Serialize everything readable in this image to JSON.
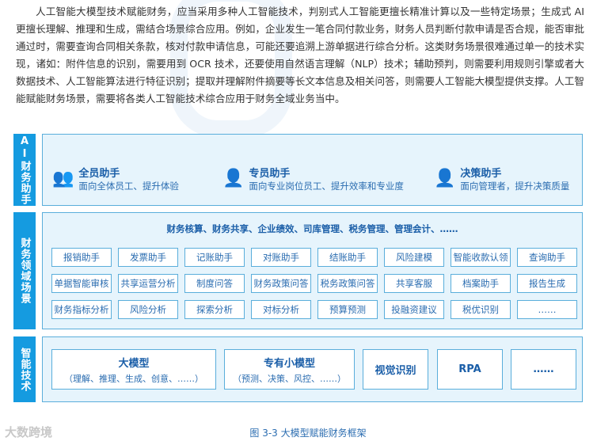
{
  "paragraph": "人工智能大模型技术赋能财务，应当采用多种人工智能技术，判别式人工智能更擅长精准计算以及一些特定场景；生成式 AI 更擅长理解、推理和生成，需结合场景综合应用。例如，企业发生一笔合同付款业务，财务人员判断付款申请是否合规，能否审批通过时，需要查询合同相关条款，核对付款申请信息，可能还要追溯上游单据进行综合分析。这类财务场景很难通过单一的技术实现，诸如：附件信息的识别，需要用到 OCR 技术，还要使用自然语言理解（NLP）技术；辅助预判，则需要利用规则引擎或者大数据技术、人工智能算法进行特征识别；提取并理解附件摘要等长文本信息及相关问答，则需要人工智能大模型提供支撑。人工智能赋能财务场景，需要将各类人工智能技术综合应用于财务全域业务当中。",
  "sections": {
    "assistant": {
      "label": "AI财务助手",
      "items": [
        {
          "title": "全员助手",
          "desc": "面向全体员工、提升体验",
          "icon": "group-people-icon"
        },
        {
          "title": "专员助手",
          "desc": "面向专业岗位员工、提升效率和专业度",
          "icon": "person-icon"
        },
        {
          "title": "决策助手",
          "desc": "面向管理者，提升决策质量",
          "icon": "manager-icon"
        }
      ]
    },
    "scenes": {
      "label": "财务领域场景",
      "header": "财务核算、财务共享、企业绩效、司库管理、税务管理、管理会计、……",
      "cells": [
        "报销助手",
        "发票助手",
        "记账助手",
        "对账助手",
        "结账助手",
        "风险建模",
        "智能收款认领",
        "查询助手",
        "单据智能审核",
        "共享运营分析",
        "制度问答",
        "财务政策问答",
        "税务政策问答",
        "共享客服",
        "档案助手",
        "报告生成",
        "财务指标分析",
        "风险分析",
        "探索分析",
        "对标分析",
        "预算预测",
        "投融资建议",
        "税优识别",
        "……"
      ]
    },
    "tech": {
      "label": "智能技术",
      "items": [
        {
          "name": "大模型",
          "sub": "（理解、推理、生成、创意、……）"
        },
        {
          "name": "专有小模型",
          "sub": "（预测、决策、风控、……）"
        },
        {
          "name": "视觉识别"
        },
        {
          "name": "RPA"
        },
        {
          "name": "……"
        }
      ]
    }
  },
  "caption": "图 3-3 大模型赋能财务框架",
  "watermark": "大数跨境"
}
